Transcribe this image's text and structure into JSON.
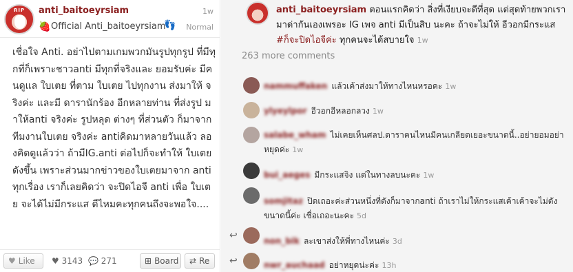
{
  "post": {
    "username": "anti_baitoeyrsiam",
    "time": "1w",
    "subtitle": "Official Anti_baitoeyrsiam",
    "mode": "Normal",
    "avatar_text": "RIP",
    "body": "เชื่อใจ Anti. อย่าไปตามเกมพวกมันรูปทุกรูป ที่มีทุกที่ก็เพราะชาวanti มีทุกที่จริงและ ยอมรับค่ะ มีคนดูแล ใบเตย ที่ตาม ใบเตย ไปทุกงาน ส่งมาให้ จริงค่ะ และมี ดารานักร้อง อีกหลายท่าน ที่ส่งรูป มาให้anti จริงค่ะ รูปหลุด ต่างๆ ที่ส่วนตัว ก็มาจากทีมงานใบเตย จริงค่ะ antiคิดมาหลายวันแล้ว ลองคิดดูแล้วว่า ถ้ามีIG.anti ต่อไปก็จะทำให้ ใบเตย ดังขึ้น เพราะส่วนมากข่าวของใบเตยมาจาก anti ทุกเรื่อง เราก็เลยคิดว่า จะปิดไอจี anti เพื่อ ใบเตย จะได้ไม่มีกระแส ดีไหมคะทุกคนถึงจะพอใจ....",
    "like_label": "Like",
    "likes": "3143",
    "comments": "271",
    "board_label": "Board",
    "re_label": "Re"
  },
  "caption": {
    "username": "anti_baitoeyrsiam",
    "text_before": "ตอนแรกคิดว่า สิ่งที่เงียบจะดีที่สุด แต่สุดท้ายพวกเรา มาด่ากันเองเพรอะ IG เพจ anti มีเป็นสิบ นะคะ ถ้าจะไม่ให้ อีวอกมีกระแส",
    "hashtag": "#ก็จะปิดไอจีค่ะ",
    "text_after": "ทุกคนจะได้สบายใจ",
    "time": "1w"
  },
  "more_comments": "263 more comments",
  "comments": [
    {
      "name": "nammuffaken",
      "text": "แล้วเค้าส่งมาให้ทางไหนหรอคะ",
      "time": "1w",
      "reply": false
    },
    {
      "name": "ylyeylpor",
      "text": "อีวอกอีหลอกลวง",
      "time": "1w",
      "reply": false
    },
    {
      "name": "salabe_wham",
      "text": "ไม่เคยเห็นศลป.ดาราคนไหนมีคนเกลียดเยอะขนาดนี้..อย่ายอมอย่าหยุดค่ะ",
      "time": "1w",
      "reply": false
    },
    {
      "name": "bui_aeges",
      "text": "มีกระแสจิง แต่ในทางลบนะคะ",
      "time": "1w",
      "reply": false
    },
    {
      "name": "somjitaz",
      "text": "ปิดเถอะค่ะส่วนหนึ่งที่ดังก็มาจากanti ถ้าเราไม่ให้กระแสเค้าเค้าจะไม่ดังขนาดนี้ค่ะ เชื่อเถอะนะคะ",
      "time": "5d",
      "reply": false
    },
    {
      "name": "non_bik",
      "text": "ละเขาส่งให้พี่ทางไหนค่ะ",
      "time": "3d",
      "reply": true
    },
    {
      "name": "nwr_auchaad",
      "text": "อย่าหยุดน่ะค่ะ",
      "time": "13h",
      "reply": true
    }
  ],
  "colors": {
    "accent": "#8b2020",
    "muted": "#999999",
    "right_bg": "#f4f4f4"
  },
  "icons": [
    "strawberry-icon",
    "footprint-icon",
    "heart-icon",
    "comment-icon",
    "board-icon",
    "repin-icon",
    "reply-icon"
  ]
}
